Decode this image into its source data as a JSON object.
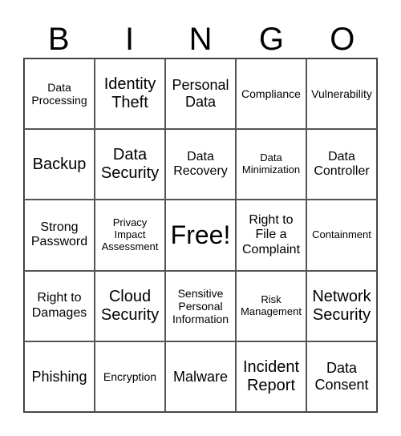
{
  "header": [
    "B",
    "I",
    "N",
    "G",
    "O"
  ],
  "cells": [
    {
      "text": "Data Processing",
      "size": "s14"
    },
    {
      "text": "Identity Theft",
      "size": "s20"
    },
    {
      "text": "Personal Data",
      "size": "s18"
    },
    {
      "text": "Compliance",
      "size": "s14"
    },
    {
      "text": "Vulnerability",
      "size": "s14"
    },
    {
      "text": "Backup",
      "size": "s20"
    },
    {
      "text": "Data Security",
      "size": "s20"
    },
    {
      "text": "Data Recovery",
      "size": "s16"
    },
    {
      "text": "Data Minimization",
      "size": "s13"
    },
    {
      "text": "Data Controller",
      "size": "s16"
    },
    {
      "text": "Strong Password",
      "size": "s16"
    },
    {
      "text": "Privacy Impact Assessment",
      "size": "s13"
    },
    {
      "text": "Free!",
      "size": "s30"
    },
    {
      "text": "Right to File a Complaint",
      "size": "s16"
    },
    {
      "text": "Containment",
      "size": "s13"
    },
    {
      "text": "Right to Damages",
      "size": "s16"
    },
    {
      "text": "Cloud Security",
      "size": "s20"
    },
    {
      "text": "Sensitive Personal Information",
      "size": "s14"
    },
    {
      "text": "Risk Management",
      "size": "s13"
    },
    {
      "text": "Network Security",
      "size": "s20"
    },
    {
      "text": "Phishing",
      "size": "s18"
    },
    {
      "text": "Encryption",
      "size": "s14"
    },
    {
      "text": "Malware",
      "size": "s18"
    },
    {
      "text": "Incident Report",
      "size": "s20"
    },
    {
      "text": "Data Consent",
      "size": "s18"
    }
  ]
}
